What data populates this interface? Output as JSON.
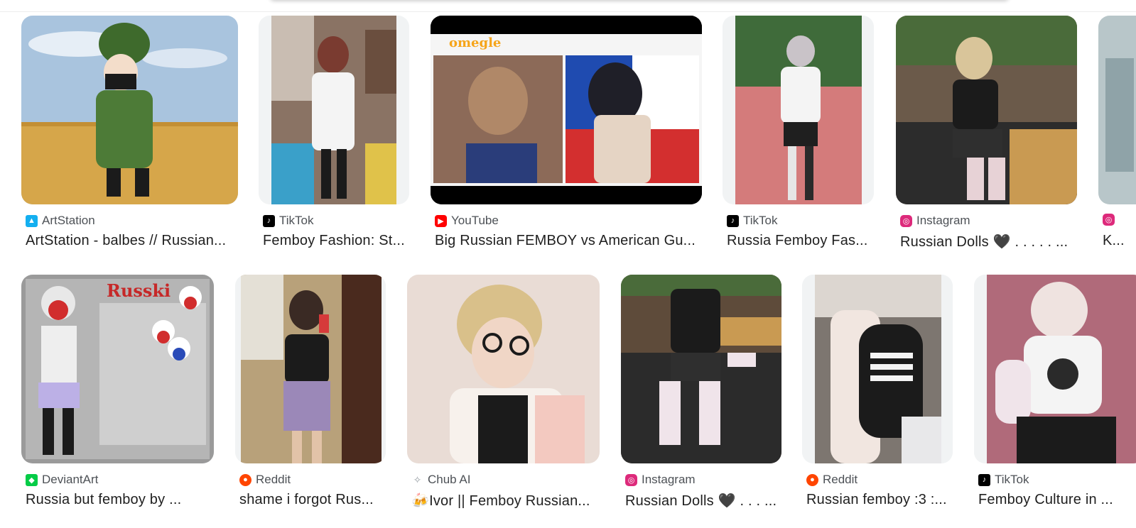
{
  "results": [
    {
      "source": "ArtStation",
      "icon": "artstation-icon",
      "color": "#13aff0",
      "title": "ArtStation - balbes // Russian..."
    },
    {
      "source": "TikTok",
      "icon": "tiktok-icon",
      "color": "#000000",
      "title": "Femboy Fashion: St..."
    },
    {
      "source": "YouTube",
      "icon": "youtube-icon",
      "color": "#ff0000",
      "title": "Big Russian FEMBOY vs American Gu...",
      "overlay_brand": "omegle"
    },
    {
      "source": "TikTok",
      "icon": "tiktok-icon",
      "color": "#000000",
      "title": "Russia Femboy Fas..."
    },
    {
      "source": "Instagram",
      "icon": "instagram-icon",
      "color": "#dd2a7b",
      "title": "Russian Dolls 🖤 . . . . . ..."
    },
    {
      "source": "",
      "icon": "instagram-icon",
      "color": "#dd2a7b",
      "title": "K..."
    },
    {
      "source": "DeviantArt",
      "icon": "deviantart-icon",
      "color": "#05cc47",
      "title": "Russia but femboy by ...",
      "overlay_text": "Russki"
    },
    {
      "source": "Reddit",
      "icon": "reddit-icon",
      "color": "#ff4500",
      "title": "shame i forgot Rus..."
    },
    {
      "source": "Chub AI",
      "icon": "chub-ai-icon",
      "color": "#9aa0a6",
      "title": "🍻Ivor || Femboy Russian..."
    },
    {
      "source": "Instagram",
      "icon": "instagram-icon",
      "color": "#dd2a7b",
      "title": "Russian Dolls 🖤 . . . ..."
    },
    {
      "source": "Reddit",
      "icon": "reddit-icon",
      "color": "#ff4500",
      "title": "Russian femboy :3 :..."
    },
    {
      "source": "TikTok",
      "icon": "tiktok-icon",
      "color": "#000000",
      "title": "Femboy Culture in ..."
    }
  ]
}
